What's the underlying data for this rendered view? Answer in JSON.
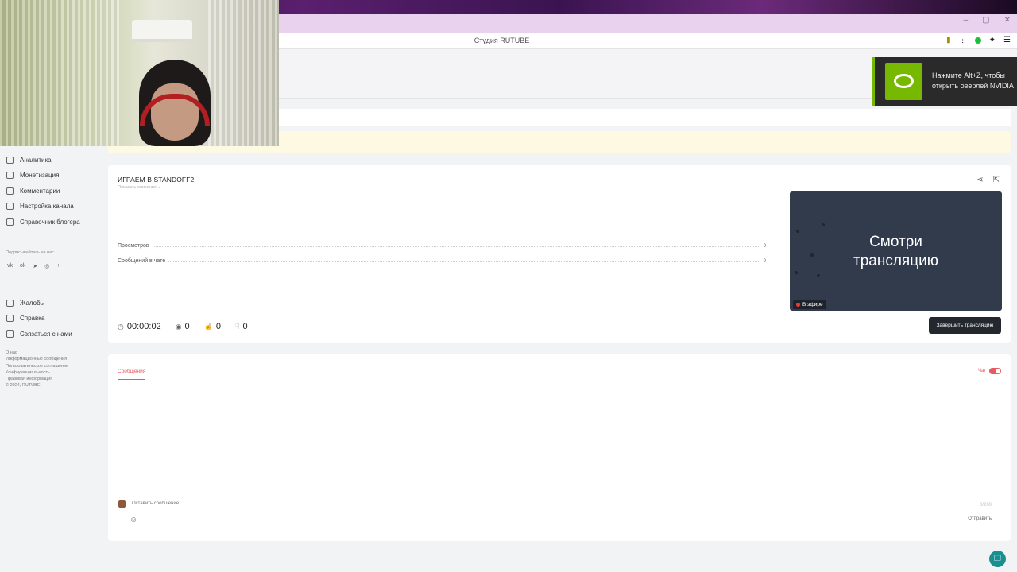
{
  "browser": {
    "tab_title": "Студия RUTUBE"
  },
  "sidebar": {
    "items": [
      {
        "label": "Аналитика",
        "icon": "analytics-icon"
      },
      {
        "label": "Монетизация",
        "icon": "monetization-icon"
      },
      {
        "label": "Комментарии",
        "icon": "comments-icon"
      },
      {
        "label": "Настройка канала",
        "icon": "channel-settings-icon"
      },
      {
        "label": "Справочник блогера",
        "icon": "handbook-icon"
      }
    ],
    "follow_label": "Подписывайтесь на нас",
    "socials": [
      "VK",
      "OK",
      "TG",
      "ZN",
      "+"
    ],
    "bottom_items": [
      {
        "label": "Жалобы",
        "icon": "flag-icon"
      },
      {
        "label": "Справка",
        "icon": "help-icon"
      },
      {
        "label": "Связаться с нами",
        "icon": "mail-icon"
      }
    ],
    "footer_links": [
      "О нас",
      "Информационные сообщения",
      "Пользовательское соглашение",
      "Конфиденциальность",
      "Правовая информация",
      "© 2024, RUTUBE"
    ]
  },
  "stream": {
    "title": "ИГРАЕМ В STANDOFF2",
    "desc_link": "Показать описание",
    "stats": [
      {
        "label": "Просмотров",
        "value": "0"
      },
      {
        "label": "Сообщений в чате",
        "value": "0"
      }
    ],
    "duration": "00:00:02",
    "viewers": "0",
    "likes": "0",
    "dislikes": "0",
    "preview_line1": "Смотри",
    "preview_line2": "трансляцию",
    "live_label": "В эфире",
    "end_button": "Завершить трансляцию"
  },
  "chat": {
    "tab_label": "Сообщения",
    "toggle_label": "Чат",
    "toggle_on": true,
    "input_placeholder": "Оставить сообщение",
    "char_counter": "0/200",
    "send_label": "Отправить"
  },
  "notification": {
    "line1": "Нажмите Alt+Z, чтобы",
    "line2": "открыть оверлей NVIDIA"
  },
  "colors": {
    "accent": "#e85a62",
    "nvidia_green": "#76b900",
    "preview_bg": "#323b4c"
  }
}
